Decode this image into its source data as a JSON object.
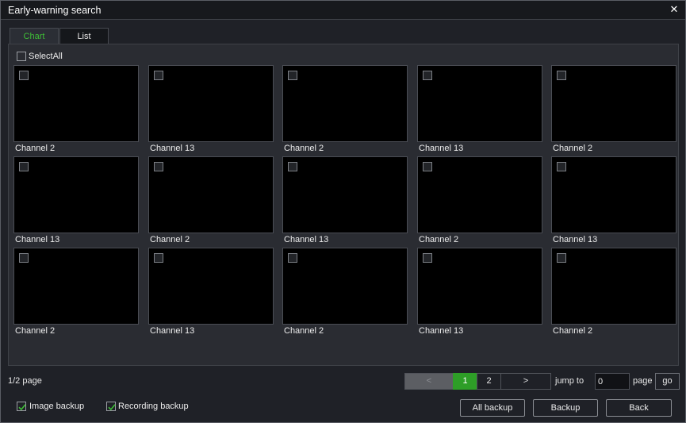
{
  "window": {
    "title": "Early-warning search",
    "close_glyph": "✕"
  },
  "tabs": [
    {
      "label": "Chart",
      "active": true
    },
    {
      "label": "List",
      "active": false
    }
  ],
  "select_all": {
    "label": "SelectAll",
    "checked": false
  },
  "grid": {
    "rows": [
      [
        "Channel 2",
        "Channel 13",
        "Channel 2",
        "Channel 13",
        "Channel 2"
      ],
      [
        "Channel 13",
        "Channel 2",
        "Channel 13",
        "Channel 2",
        "Channel 13"
      ],
      [
        "Channel 2",
        "Channel 13",
        "Channel 2",
        "Channel 13",
        "Channel 2"
      ]
    ]
  },
  "pagination": {
    "page_info": "1/2 page",
    "prev": "<",
    "pages": [
      "1",
      "2"
    ],
    "current_page": "1",
    "next": ">",
    "jump_label": "jump to",
    "jump_value": "0",
    "page_label": "page",
    "go_label": "go"
  },
  "options": {
    "image_backup": {
      "label": "Image backup",
      "checked": true
    },
    "recording_backup": {
      "label": "Recording backup",
      "checked": true
    }
  },
  "actions": {
    "all_backup": "All backup",
    "backup": "Backup",
    "back": "Back"
  },
  "colors": {
    "accent_green": "#2e9e27",
    "active_tab_text": "#3ebd36",
    "thumbnail_bg": "#000000"
  }
}
